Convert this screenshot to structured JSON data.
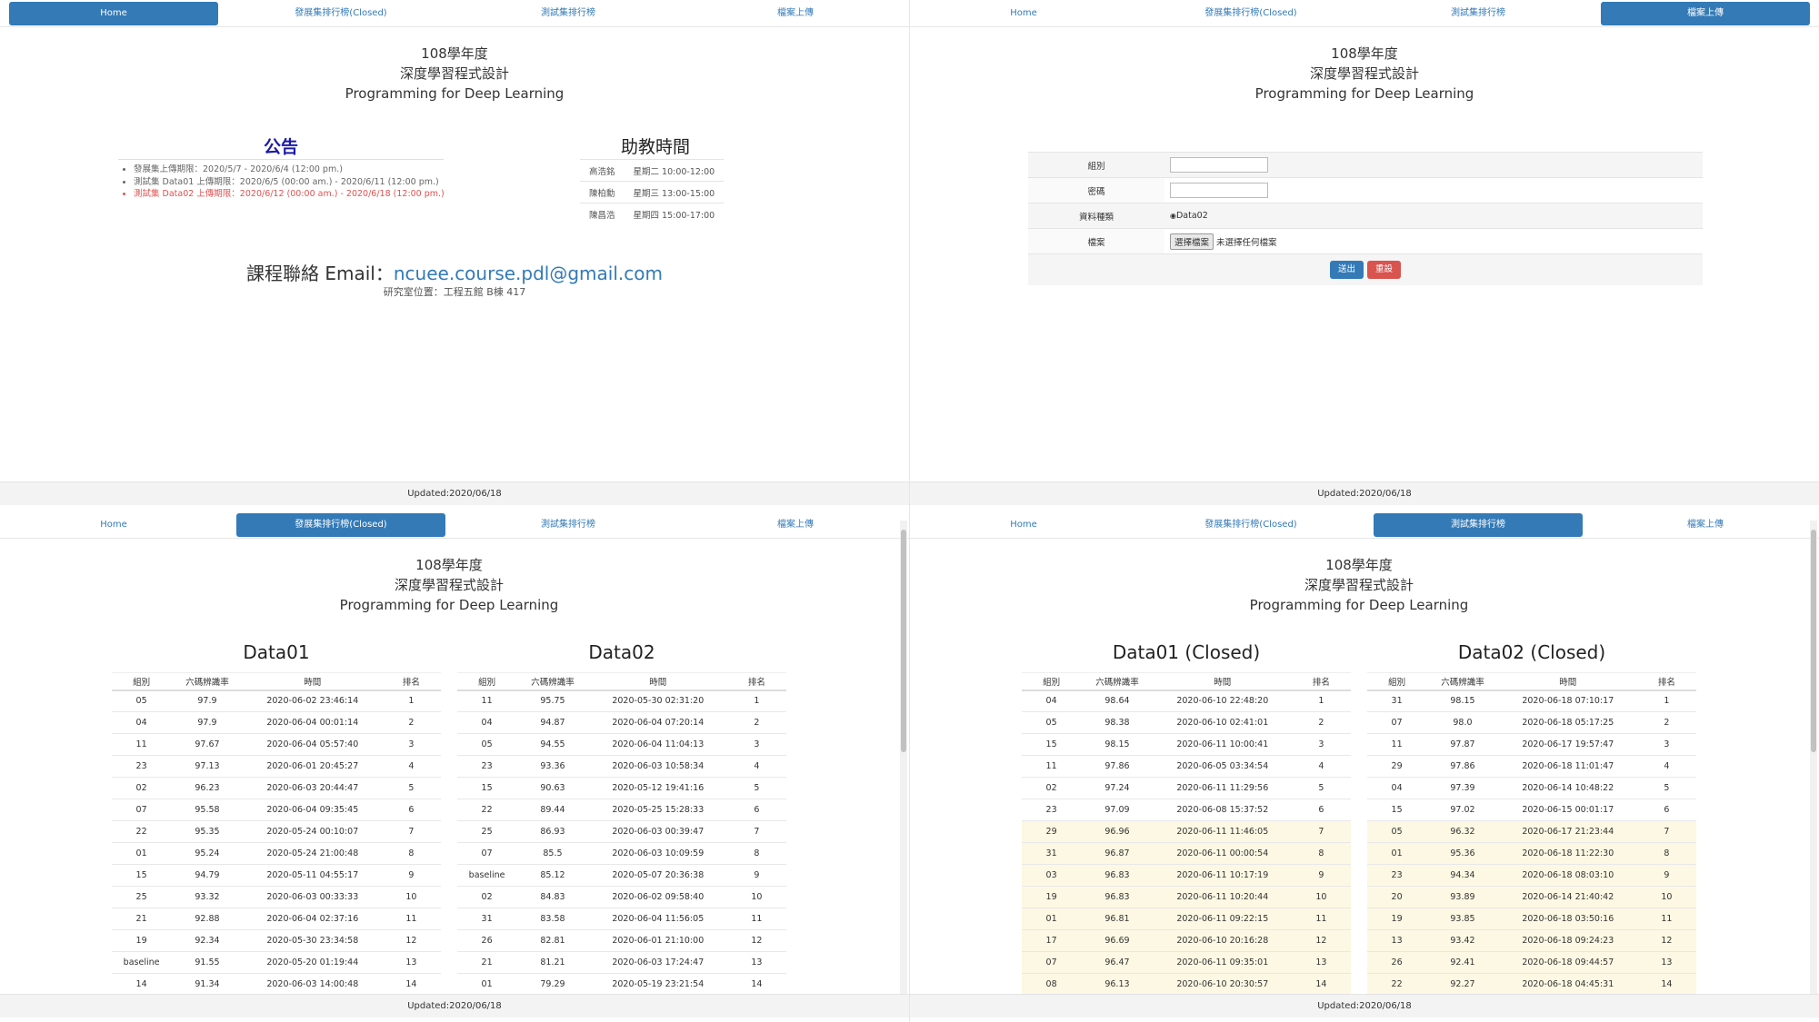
{
  "nav": {
    "home": "Home",
    "dev": "發展集排行榜(Closed)",
    "test": "測試集排行榜",
    "upload": "檔案上傳"
  },
  "header": {
    "year": "108學年度",
    "course_zh": "深度學習程式設計",
    "course_en": "Programming for Deep Learning"
  },
  "footer": "Updated:2020/06/18",
  "home": {
    "announce_title": "公告",
    "announcements": [
      "發展集上傳期限：2020/5/7 - 2020/6/4 (12:00 pm.)",
      "測試集 Data01 上傳期限：2020/6/5 (00:00 am.) - 2020/6/11 (12:00 pm.)",
      "測試集 Data02 上傳期限：2020/6/12 (00:00 am.) - 2020/6/18 (12:00 pm.)"
    ],
    "ta_title": "助教時間",
    "ta": [
      [
        "高浩銘",
        "星期二 10:00-12:00"
      ],
      [
        "陳柏勳",
        "星期三 13:00-15:00"
      ],
      [
        "陳昌浩",
        "星期四 15:00-17:00"
      ]
    ],
    "email_label": "課程聯絡 Email：",
    "email": "ncuee.course.pdl@gmail.com",
    "lab": "研究室位置：工程五館 B棟 417"
  },
  "upload": {
    "group_label": "組別",
    "password_label": "密碼",
    "type_label": "資料種類",
    "type_value": "Data02",
    "file_label": "檔案",
    "file_button": "選擇檔案",
    "file_none": "未選擇任何檔案",
    "submit": "送出",
    "reset": "重設"
  },
  "headers": [
    "組別",
    "六碼辨識率",
    "時間",
    "排名"
  ],
  "dev": {
    "data01_title": "Data01",
    "data02_title": "Data02",
    "data01": [
      [
        "05",
        "97.9",
        "2020-06-02 23:46:14",
        "1"
      ],
      [
        "04",
        "97.9",
        "2020-06-04 00:01:14",
        "2"
      ],
      [
        "11",
        "97.67",
        "2020-06-04 05:57:40",
        "3"
      ],
      [
        "23",
        "97.13",
        "2020-06-01 20:45:27",
        "4"
      ],
      [
        "02",
        "96.23",
        "2020-06-03 20:44:47",
        "5"
      ],
      [
        "07",
        "95.58",
        "2020-06-04 09:35:45",
        "6"
      ],
      [
        "22",
        "95.35",
        "2020-05-24 00:10:07",
        "7"
      ],
      [
        "01",
        "95.24",
        "2020-05-24 21:00:48",
        "8"
      ],
      [
        "15",
        "94.79",
        "2020-05-11 04:55:17",
        "9"
      ],
      [
        "25",
        "93.32",
        "2020-06-03 00:33:33",
        "10"
      ],
      [
        "21",
        "92.88",
        "2020-06-04 02:37:16",
        "11"
      ],
      [
        "19",
        "92.34",
        "2020-05-30 23:34:58",
        "12"
      ],
      [
        "baseline",
        "91.55",
        "2020-05-20 01:19:44",
        "13"
      ],
      [
        "14",
        "91.34",
        "2020-06-03 14:00:48",
        "14"
      ]
    ],
    "data02": [
      [
        "11",
        "95.75",
        "2020-05-30 02:31:20",
        "1"
      ],
      [
        "04",
        "94.87",
        "2020-06-04 07:20:14",
        "2"
      ],
      [
        "05",
        "94.55",
        "2020-06-04 11:04:13",
        "3"
      ],
      [
        "23",
        "93.36",
        "2020-06-03 10:58:34",
        "4"
      ],
      [
        "15",
        "90.63",
        "2020-05-12 19:41:16",
        "5"
      ],
      [
        "22",
        "89.44",
        "2020-05-25 15:28:33",
        "6"
      ],
      [
        "25",
        "86.93",
        "2020-06-03 00:39:47",
        "7"
      ],
      [
        "07",
        "85.5",
        "2020-06-03 10:09:59",
        "8"
      ],
      [
        "baseline",
        "85.12",
        "2020-05-07 20:36:38",
        "9"
      ],
      [
        "02",
        "84.83",
        "2020-06-02 09:58:40",
        "10"
      ],
      [
        "31",
        "83.58",
        "2020-06-04 11:56:05",
        "11"
      ],
      [
        "26",
        "82.81",
        "2020-06-01 21:10:00",
        "12"
      ],
      [
        "21",
        "81.21",
        "2020-06-03 17:24:47",
        "13"
      ],
      [
        "01",
        "79.29",
        "2020-05-19 23:21:54",
        "14"
      ]
    ]
  },
  "test": {
    "data01_title": "Data01 (Closed)",
    "data02_title": "Data02 (Closed)",
    "data01": [
      [
        "04",
        "98.64",
        "2020-06-10 22:48:20",
        "1"
      ],
      [
        "05",
        "98.38",
        "2020-06-10 02:41:01",
        "2"
      ],
      [
        "15",
        "98.15",
        "2020-06-11 10:00:41",
        "3"
      ],
      [
        "11",
        "97.86",
        "2020-06-05 03:34:54",
        "4"
      ],
      [
        "02",
        "97.24",
        "2020-06-11 11:29:56",
        "5"
      ],
      [
        "23",
        "97.09",
        "2020-06-08 15:37:52",
        "6"
      ],
      [
        "29",
        "96.96",
        "2020-06-11 11:46:05",
        "7"
      ],
      [
        "31",
        "96.87",
        "2020-06-11 00:00:54",
        "8"
      ],
      [
        "03",
        "96.83",
        "2020-06-11 10:17:19",
        "9"
      ],
      [
        "19",
        "96.83",
        "2020-06-11 10:20:44",
        "10"
      ],
      [
        "01",
        "96.81",
        "2020-06-11 09:22:15",
        "11"
      ],
      [
        "17",
        "96.69",
        "2020-06-10 20:16:28",
        "12"
      ],
      [
        "07",
        "96.47",
        "2020-06-11 09:35:01",
        "13"
      ],
      [
        "08",
        "96.13",
        "2020-06-10 20:30:57",
        "14"
      ]
    ],
    "data02": [
      [
        "31",
        "98.15",
        "2020-06-18 07:10:17",
        "1"
      ],
      [
        "07",
        "98.0",
        "2020-06-18 05:17:25",
        "2"
      ],
      [
        "11",
        "97.87",
        "2020-06-17 19:57:47",
        "3"
      ],
      [
        "29",
        "97.86",
        "2020-06-18 11:01:47",
        "4"
      ],
      [
        "04",
        "97.39",
        "2020-06-14 10:48:22",
        "5"
      ],
      [
        "15",
        "97.02",
        "2020-06-15 00:01:17",
        "6"
      ],
      [
        "05",
        "96.32",
        "2020-06-17 21:23:44",
        "7"
      ],
      [
        "01",
        "95.36",
        "2020-06-18 11:22:30",
        "8"
      ],
      [
        "23",
        "94.34",
        "2020-06-18 08:03:10",
        "9"
      ],
      [
        "20",
        "93.89",
        "2020-06-14 21:40:42",
        "10"
      ],
      [
        "19",
        "93.85",
        "2020-06-18 03:50:16",
        "11"
      ],
      [
        "13",
        "93.42",
        "2020-06-18 09:24:23",
        "12"
      ],
      [
        "26",
        "92.41",
        "2020-06-18 09:44:57",
        "13"
      ],
      [
        "22",
        "92.27",
        "2020-06-18 04:45:31",
        "14"
      ]
    ]
  }
}
